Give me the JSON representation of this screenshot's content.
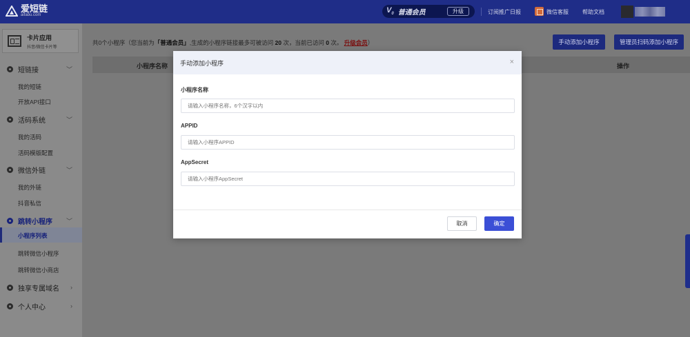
{
  "brand": {
    "name": "爱短链",
    "domain": "aifabu.com"
  },
  "header": {
    "vip_label": "普通会员",
    "upgrade_label": "升级",
    "links": [
      "订阅推广日报",
      "微信客服",
      "帮助文档"
    ]
  },
  "sidebar": {
    "card_title": "卡片应用",
    "card_subtitle": "抖音/微信卡片等",
    "groups": [
      {
        "label": "短链接",
        "items": [
          "我的短链",
          "开放API接口"
        ]
      },
      {
        "label": "活码系统",
        "items": [
          "我的活码",
          "活码模版配置"
        ]
      },
      {
        "label": "微信外链",
        "items": [
          "我的外链",
          "抖音私信"
        ]
      },
      {
        "label": "跳转小程序",
        "items": [
          "小程序列表",
          "跳转微信小程序",
          "跳转微信小商店"
        ]
      },
      {
        "label": "独享专属域名",
        "items": []
      },
      {
        "label": "个人中心",
        "items": []
      }
    ],
    "active_item": "小程序列表"
  },
  "main": {
    "stats": {
      "prefix": "共0个小程序（您当前为",
      "level": "「普通会员」",
      "middle": ",生成的小程序链接最多可被访问",
      "max_visits": "20",
      "middle2": "次，当前已访问",
      "current_visits": "0",
      "suffix": "次。",
      "upgrade_link": "升级会员",
      "close": "）"
    },
    "buttons": {
      "manual_add": "手动添加小程序",
      "admin_scan_add": "管理员扫码添加小程序"
    },
    "table_headers": [
      "小程序名称",
      "操作"
    ]
  },
  "modal": {
    "title": "手动添加小程序",
    "close_glyph": "×",
    "fields": [
      {
        "label": "小程序名称",
        "placeholder": "请输入小程序名称，6个汉字以内"
      },
      {
        "label": "APPID",
        "placeholder": "请输入小程序APPID"
      },
      {
        "label": "AppSecret",
        "placeholder": "请输入小程序AppSecret"
      }
    ],
    "cancel_label": "取消",
    "confirm_label": "确定"
  },
  "colors": {
    "topbar": "#1f2d88",
    "primary_button": "#3b4fd6",
    "overlay": "#7a7a7a"
  }
}
